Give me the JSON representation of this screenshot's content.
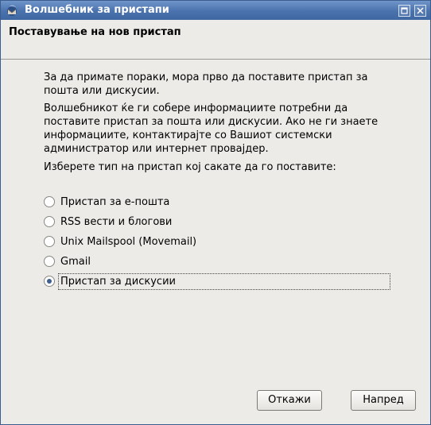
{
  "window": {
    "title": "Волшебник за пристапи",
    "controls": {
      "maximize_icon": "maximize-icon",
      "close_icon": "close-icon"
    }
  },
  "header": {
    "title": "Поставување на нов пристап"
  },
  "content": {
    "paragraph1": "За да примате пораки, мора прво да поставите пристап за пошта или дискусии.",
    "paragraph2": "Волшебникот ќе ги собере информациите потребни да поставите пристап за пошта или дискусии. Ако не ги знаете информациите, контактирајте со Вашиот системски администратор или интернет провајдер.",
    "paragraph3": "Изберете тип на пристап кој сакате да го поставите:"
  },
  "account_types": [
    {
      "label": "Пристап за е-пошта",
      "checked": false
    },
    {
      "label": "RSS вести и блогови",
      "checked": false
    },
    {
      "label": "Unix Mailspool (Movemail)",
      "checked": false
    },
    {
      "label": "Gmail",
      "checked": false
    },
    {
      "label": "Пристап за дискусии",
      "checked": true
    }
  ],
  "buttons": {
    "cancel_label": "Откажи",
    "next_label": "Напред"
  },
  "colors": {
    "titlebar": "#4a72ad",
    "background": "#edebe8",
    "radio_selected": "#3c5f8e"
  }
}
